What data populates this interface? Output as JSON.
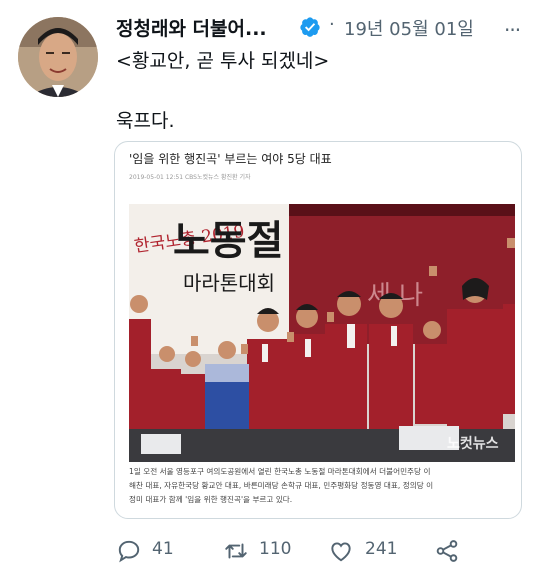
{
  "tweet": {
    "author_name": "정청래와 더불어...",
    "date": "19년 05월 01일",
    "dot": "·",
    "more": "...",
    "text_line1": "<황교안, 곧 투사 되겠네>",
    "text_line2": "욱프다."
  },
  "card": {
    "headline": "'임을 위한 행진곡' 부르는 여야 5당 대표",
    "byline": "2019-05-01 12:51    CBS노컷뉴스 황진환 기자",
    "photo_text_left": "한국노총 2019",
    "photo_text_big": "노동절",
    "photo_text_sub": "마라톤대회",
    "photo_text_right": "세 나",
    "photo_watermark": "노컷뉴스",
    "caption_lines": [
      "1일 오전 서울 영등포구 여의도공원에서 열린 한국노총 노동절 마라톤대회에서 더불어민주당 이",
      "해찬 대표, 자유한국당 황교안 대표, 바른미래당 손학규 대표, 민주평화당 정동영 대표, 정의당 이",
      "정미 대표가 함께 '임을 위한 행진곡'을 부르고 있다."
    ]
  },
  "actions": {
    "replies": "41",
    "retweets": "110",
    "likes": "241"
  },
  "icons": [
    "verified-badge-icon",
    "more-icon",
    "reply-icon",
    "retweet-icon",
    "like-icon",
    "share-icon"
  ],
  "colors": {
    "verified": "#1d9bf0",
    "muted": "#536471",
    "jacket_red": "#a3202b"
  }
}
